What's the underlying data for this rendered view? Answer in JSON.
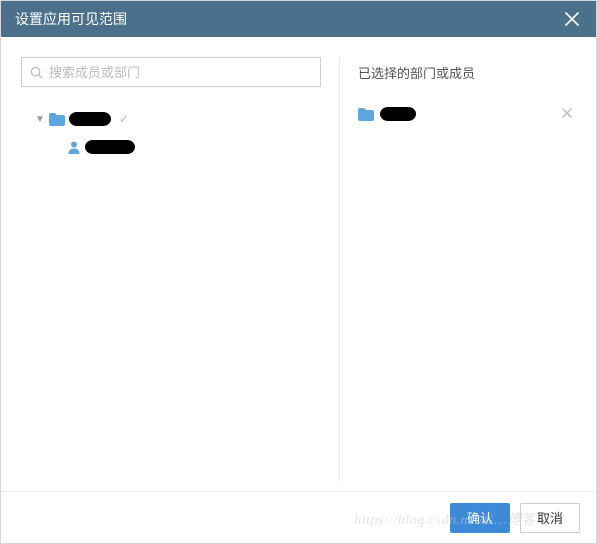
{
  "header": {
    "title": "设置应用可见范围"
  },
  "search": {
    "placeholder": "搜索成员或部门"
  },
  "tree": {
    "root_label": "",
    "child_label": ""
  },
  "right": {
    "title": "已选择的部门或成员",
    "selected_label": ""
  },
  "footer": {
    "confirm": "确认",
    "cancel": "取消"
  },
  "watermark": "https://blog.csdn.net/G…博客"
}
